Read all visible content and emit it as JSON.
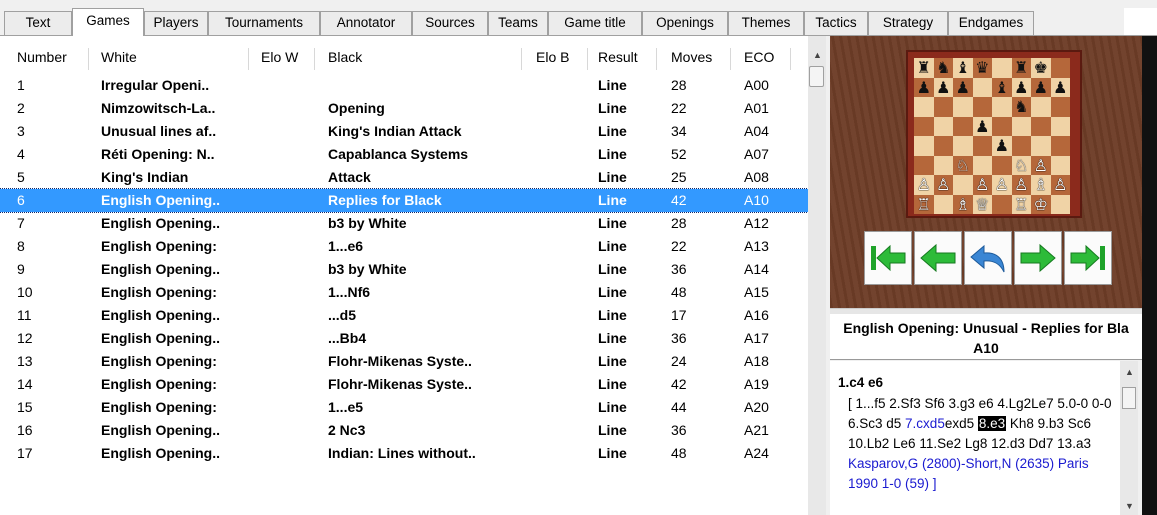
{
  "tabs": [
    "Text",
    "Games",
    "Players",
    "Tournaments",
    "Annotator",
    "Sources",
    "Teams",
    "Game title",
    "Openings",
    "Themes",
    "Tactics",
    "Strategy",
    "Endgames"
  ],
  "active_tab": "Games",
  "columns": {
    "number": "Number",
    "white": "White",
    "elo_w": "Elo W",
    "black": "Black",
    "elo_b": "Elo B",
    "result": "Result",
    "moves": "Moves",
    "eco": "ECO"
  },
  "rows": [
    {
      "number": "1",
      "white": "Irregular Openi..",
      "black": "",
      "result": "Line",
      "moves": "28",
      "eco": "A00"
    },
    {
      "number": "2",
      "white": "Nimzowitsch-La..",
      "black": "Opening",
      "result": "Line",
      "moves": "22",
      "eco": "A01"
    },
    {
      "number": "3",
      "white": "Unusual lines af..",
      "black": "King's Indian Attack",
      "result": "Line",
      "moves": "34",
      "eco": "A04"
    },
    {
      "number": "4",
      "white": "Réti Opening: N..",
      "black": "Capablanca Systems",
      "result": "Line",
      "moves": "52",
      "eco": "A07"
    },
    {
      "number": "5",
      "white": "King's Indian",
      "black": "Attack",
      "result": "Line",
      "moves": "25",
      "eco": "A08"
    },
    {
      "number": "6",
      "white": "English Opening..",
      "black": "Replies for Black",
      "result": "Line",
      "moves": "42",
      "eco": "A10",
      "selected": true
    },
    {
      "number": "7",
      "white": "English Opening..",
      "black": "b3 by White",
      "result": "Line",
      "moves": "28",
      "eco": "A12"
    },
    {
      "number": "8",
      "white": "English Opening:",
      "black": "1...e6",
      "result": "Line",
      "moves": "22",
      "eco": "A13"
    },
    {
      "number": "9",
      "white": "English Opening..",
      "black": "b3 by White",
      "result": "Line",
      "moves": "36",
      "eco": "A14"
    },
    {
      "number": "10",
      "white": "English Opening:",
      "black": "1...Nf6",
      "result": "Line",
      "moves": "48",
      "eco": "A15"
    },
    {
      "number": "11",
      "white": "English Opening..",
      "black": "...d5",
      "result": "Line",
      "moves": "17",
      "eco": "A16"
    },
    {
      "number": "12",
      "white": "English Opening..",
      "black": "...Bb4",
      "result": "Line",
      "moves": "36",
      "eco": "A17"
    },
    {
      "number": "13",
      "white": "English Opening:",
      "black": "Flohr-Mikenas Syste..",
      "result": "Line",
      "moves": "24",
      "eco": "A18"
    },
    {
      "number": "14",
      "white": "English Opening:",
      "black": "Flohr-Mikenas Syste..",
      "result": "Line",
      "moves": "42",
      "eco": "A19"
    },
    {
      "number": "15",
      "white": "English Opening:",
      "black": "1...e5",
      "result": "Line",
      "moves": "44",
      "eco": "A20"
    },
    {
      "number": "16",
      "white": "English Opening..",
      "black": "2 Nc3",
      "result": "Line",
      "moves": "36",
      "eco": "A21"
    },
    {
      "number": "17",
      "white": "English Opening..",
      "black": "Indian: Lines without..",
      "result": "Line",
      "moves": "48",
      "eco": "A24"
    }
  ],
  "board": {
    "ranks": [
      [
        "r",
        "n",
        "b",
        "q",
        "",
        "r",
        "k",
        ""
      ],
      [
        "p",
        "p",
        "p",
        "",
        "b",
        "p",
        "p",
        "p"
      ],
      [
        "",
        "",
        "",
        "",
        "",
        "n",
        "",
        ""
      ],
      [
        "",
        "",
        "",
        "p",
        "",
        "",
        "",
        ""
      ],
      [
        "",
        "",
        "",
        "",
        "p",
        "",
        "",
        ""
      ],
      [
        "",
        "",
        "N",
        "",
        "",
        "N",
        "P",
        ""
      ],
      [
        "P",
        "P",
        "",
        "P",
        "P",
        "P",
        "B",
        "P"
      ],
      [
        "R",
        "",
        "B",
        "Q",
        "",
        "R",
        "K",
        ""
      ]
    ],
    "light_square": "#f0d3a6",
    "dark_square": "#b5673a"
  },
  "nav_icons": [
    "first-move-icon",
    "previous-move-icon",
    "take-back-icon",
    "next-move-icon",
    "last-move-icon"
  ],
  "game_title": {
    "line1": "English Opening: Unusual - Replies for Bla",
    "line2": "A10"
  },
  "notation": {
    "first_line": "1.c4  e6",
    "variation": [
      {
        "t": "[ 1...f5  2.Sf3  Sf6  3.g3  e6  4.Lg2"
      },
      {
        "t": "Le7  5.0-0  0-0  6.Sc3  d5  "
      },
      {
        "t": "7.cxd5",
        "blue": true
      },
      {
        "t": "exd5  "
      },
      {
        "t": "8.e3",
        "current": true
      },
      {
        "t": "  Kh8  9.b3  Sc6  10.Lb2  Le6  11.Se2  Lg8  12.d3  Dd7  13.a3  "
      },
      {
        "t": "Kasparov,G (2800)-Short,N (2635)",
        "blue": true
      },
      {
        "t": "  Paris 1990 1-0 (59) ]",
        "blue": true
      }
    ]
  }
}
